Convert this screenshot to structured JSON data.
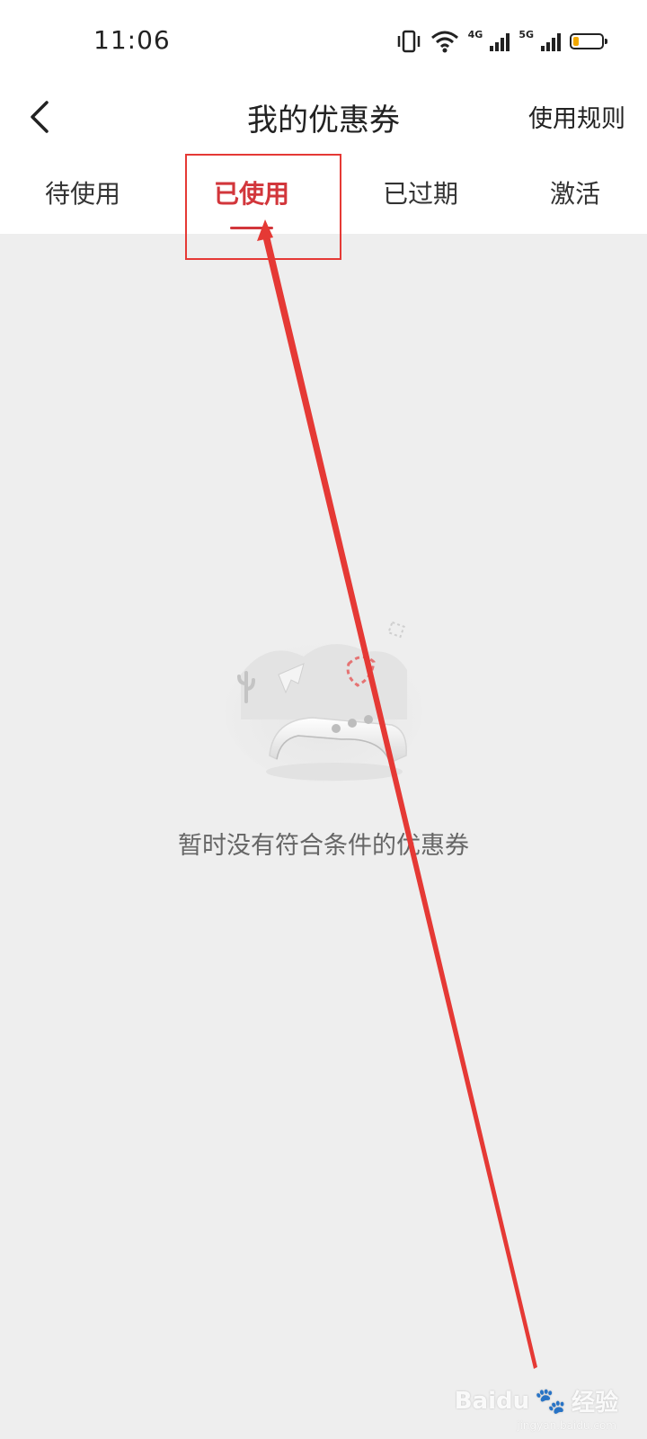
{
  "status_bar": {
    "time": "11:06",
    "network_4g": "4G",
    "network_5g": "5G",
    "battery_level": 0.2,
    "battery_color": "#f2a800"
  },
  "nav": {
    "title": "我的优惠券",
    "rules": "使用规则",
    "back_icon": "chevron-left-icon"
  },
  "tabs": [
    {
      "label": "待使用",
      "active": false
    },
    {
      "label": "已使用",
      "active": true
    },
    {
      "label": "已过期",
      "active": false
    },
    {
      "label": "激活",
      "active": false
    }
  ],
  "empty_state": {
    "message": "暂时没有符合条件的优惠券",
    "icon": "empty-coupon-illustration"
  },
  "annotation": {
    "color": "#e53935"
  },
  "watermark": {
    "brand": "Baidu",
    "text": "经验",
    "sub": "jingyan.baidu.com"
  },
  "colors": {
    "accent": "#d2363b",
    "background": "#eeeeee"
  }
}
